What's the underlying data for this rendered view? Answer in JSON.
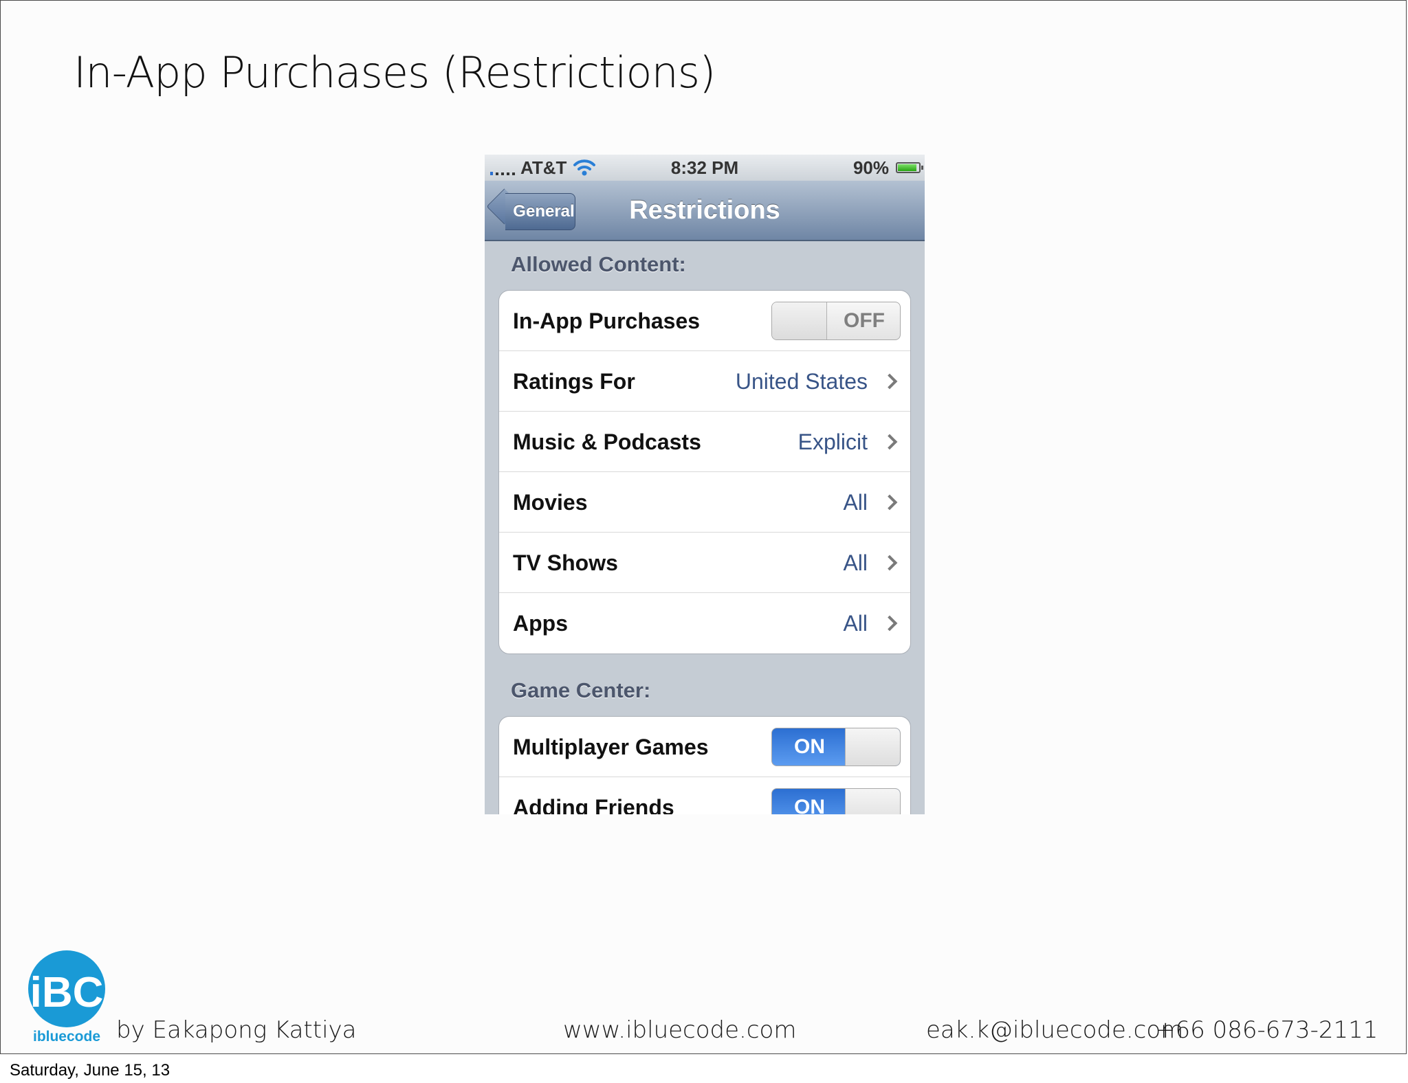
{
  "slide": {
    "title": "In-App Purchases (Restrictions)",
    "date": "Saturday, June 15, 13"
  },
  "phone": {
    "status_bar": {
      "carrier": "AT&T",
      "time": "8:32 PM",
      "battery": "90%",
      "battery_level": 0.9
    },
    "nav_bar": {
      "back_label": "General",
      "title": "Restrictions"
    },
    "sections": [
      {
        "header": "Allowed Content:",
        "rows": [
          {
            "label": "In-App Purchases",
            "switch": "OFF"
          },
          {
            "label": "Ratings For",
            "value": "United States"
          },
          {
            "label": "Music & Podcasts",
            "value": "Explicit"
          },
          {
            "label": "Movies",
            "value": "All"
          },
          {
            "label": "TV Shows",
            "value": "All"
          },
          {
            "label": "Apps",
            "value": "All"
          }
        ]
      },
      {
        "header": "Game Center:",
        "rows": [
          {
            "label": "Multiplayer Games",
            "switch": "ON"
          },
          {
            "label": "Adding Friends",
            "switch": "ON"
          }
        ]
      }
    ]
  },
  "footer": {
    "logo_text": "ibluecode",
    "logo_mark": "iBC",
    "author": "by Eakapong Kattiya",
    "website": "www.ibluecode.com",
    "email": "eak.k@ibluecode.com",
    "phone": "+66 086-673-2111"
  },
  "colors": {
    "accent_blue": "#1a9ad6",
    "switch_on": "#3b82e0",
    "value_text": "#385487",
    "nav_bar": "#6f86a5"
  }
}
